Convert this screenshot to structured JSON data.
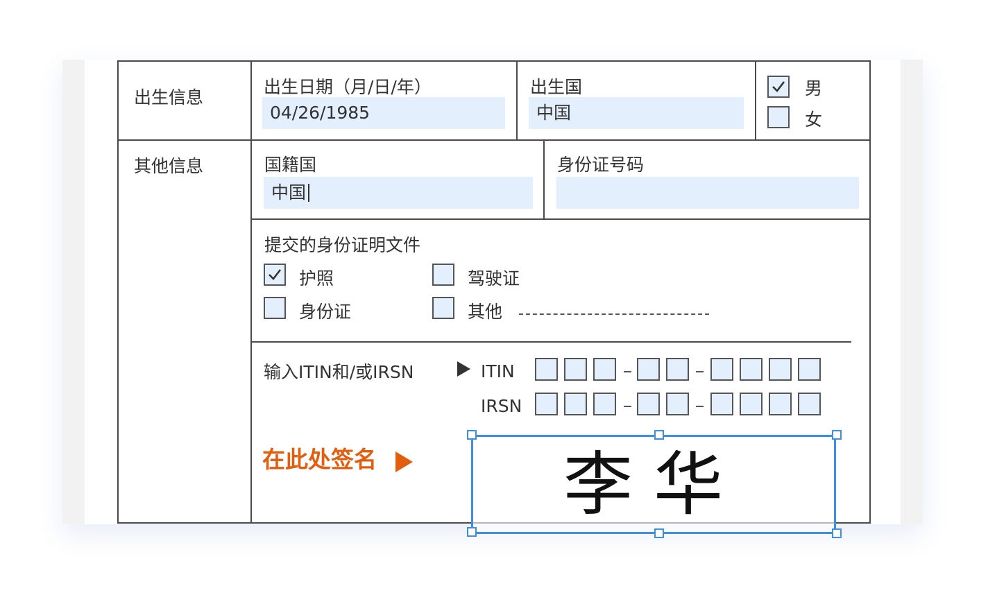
{
  "form": {
    "birth_info_label": "出生信息",
    "other_info_label": "其他信息",
    "dob": {
      "label": "出生日期（月/日/年）",
      "value": "04/26/1985"
    },
    "birth_country": {
      "label": "出生国",
      "value": "中国"
    },
    "gender": [
      {
        "label": "男",
        "checked": true
      },
      {
        "label": "女",
        "checked": false
      }
    ],
    "nationality": {
      "label": "国籍国",
      "value": "中国"
    },
    "id_number": {
      "label": "身份证号码",
      "value": ""
    },
    "documents": {
      "label": "提交的身份证明文件",
      "options": [
        {
          "label": "护照",
          "checked": true
        },
        {
          "label": "驾驶证",
          "checked": false
        },
        {
          "label": "身份证",
          "checked": false
        },
        {
          "label": "其他",
          "checked": false
        }
      ]
    },
    "itin_irsn": {
      "label": "输入ITIN和/或IRSN",
      "itin_label": "ITIN",
      "irsn_label": "IRSN"
    },
    "signature": {
      "prompt": "在此处签名",
      "value": "李华"
    }
  },
  "colors": {
    "field_bg": "#e3effd",
    "accent_orange": "#e35d0f",
    "selection_blue": "#3d8fe6",
    "border": "#4a4a4a"
  },
  "icons": [
    "checkmark-icon",
    "play-arrow-icon"
  ]
}
